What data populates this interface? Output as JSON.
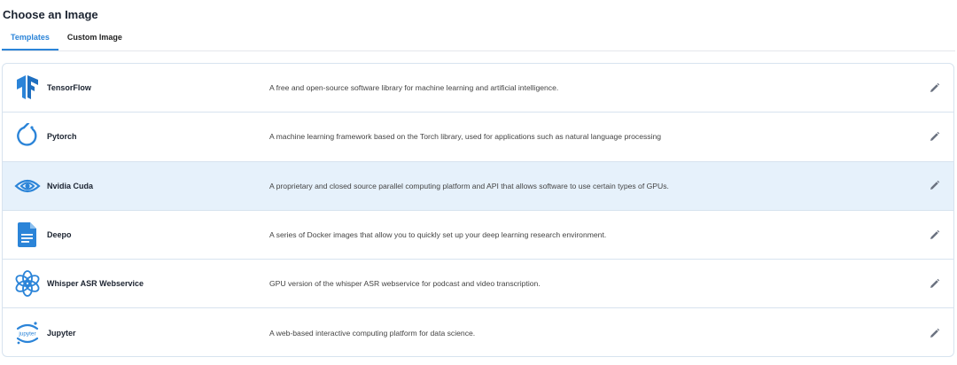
{
  "header": {
    "title": "Choose an Image"
  },
  "tabs": [
    {
      "label": "Templates",
      "active": true
    },
    {
      "label": "Custom Image",
      "active": false
    }
  ],
  "images": [
    {
      "name": "TensorFlow",
      "description": "A free and open-source software library for machine learning and artificial intelligence.",
      "icon": "tensorflow-logo-icon",
      "selected": false
    },
    {
      "name": "Pytorch",
      "description": "A machine learning framework based on the Torch library, used for applications such as natural language processing",
      "icon": "pytorch-logo-icon",
      "selected": false
    },
    {
      "name": "Nvidia Cuda",
      "description": "A proprietary and closed source parallel computing platform and API that allows software to use certain types of GPUs.",
      "icon": "nvidia-logo-icon",
      "selected": true
    },
    {
      "name": "Deepo",
      "description": "A series of Docker images that allow you to quickly set up your deep learning research environment.",
      "icon": "document-icon",
      "selected": false
    },
    {
      "name": "Whisper ASR Webservice",
      "description": "GPU version of the whisper ASR webservice for podcast and video transcription.",
      "icon": "openai-logo-icon",
      "selected": false
    },
    {
      "name": "Jupyter",
      "description": "A web-based interactive computing platform for data science.",
      "icon": "jupyter-logo-icon",
      "selected": false,
      "logo_text": "jupyter"
    }
  ],
  "colors": {
    "accent": "#2b84d8",
    "selected_row": "#e6f1fb",
    "border": "#d7e3ef"
  }
}
